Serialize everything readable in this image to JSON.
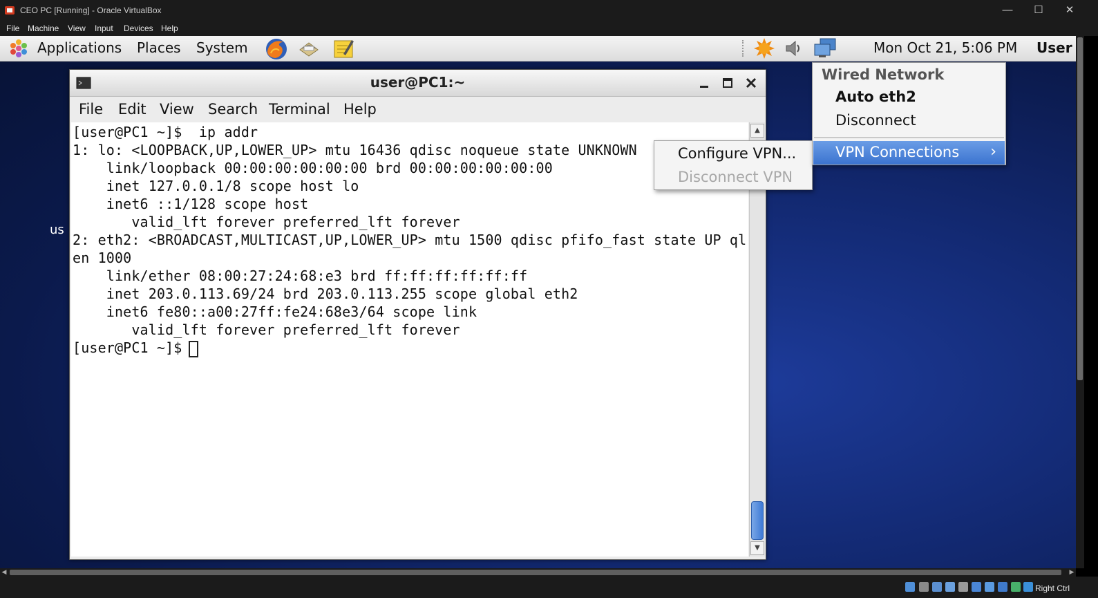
{
  "host": {
    "title": "CEO PC [Running] - Oracle VirtualBox",
    "menu": [
      "File",
      "Machine",
      "View",
      "Input",
      "Devices",
      "Help"
    ],
    "window_controls": {
      "minimize": "—",
      "maximize": "☐",
      "close": "✕"
    },
    "host_key": "Right Ctrl"
  },
  "panel": {
    "applications": "Applications",
    "places": "Places",
    "system": "System",
    "clock": "Mon Oct 21,  5:06 PM",
    "user": "User"
  },
  "desktop": {
    "partial_label": "us"
  },
  "terminal": {
    "title": "user@PC1:~",
    "menu": [
      "File",
      "Edit",
      "View",
      "Search",
      "Terminal",
      "Help"
    ],
    "lines": [
      "[user@PC1 ~]$  ip addr",
      "1: lo: <LOOPBACK,UP,LOWER_UP> mtu 16436 qdisc noqueue state UNKNOWN",
      "    link/loopback 00:00:00:00:00:00 brd 00:00:00:00:00:00",
      "    inet 127.0.0.1/8 scope host lo",
      "    inet6 ::1/128 scope host",
      "       valid_lft forever preferred_lft forever",
      "2: eth2: <BROADCAST,MULTICAST,UP,LOWER_UP> mtu 1500 qdisc pfifo_fast state UP ql",
      "en 1000",
      "    link/ether 08:00:27:24:68:e3 brd ff:ff:ff:ff:ff:ff",
      "    inet 203.0.113.69/24 brd 203.0.113.255 scope global eth2",
      "    inet6 fe80::a00:27ff:fe24:68e3/64 scope link",
      "       valid_lft forever preferred_lft forever",
      "[user@PC1 ~]$ "
    ]
  },
  "network_menu": {
    "header": "Wired Network",
    "connection": "Auto eth2",
    "disconnect": "Disconnect",
    "vpn_connections": "VPN Connections",
    "submenu": {
      "configure_vpn": "Configure VPN...",
      "disconnect_vpn": "Disconnect VPN"
    }
  },
  "colors": {
    "menu_highlight": "#4a84d9",
    "desktop_blue": "#132a74",
    "panel_bg": "#e8e8e8"
  }
}
